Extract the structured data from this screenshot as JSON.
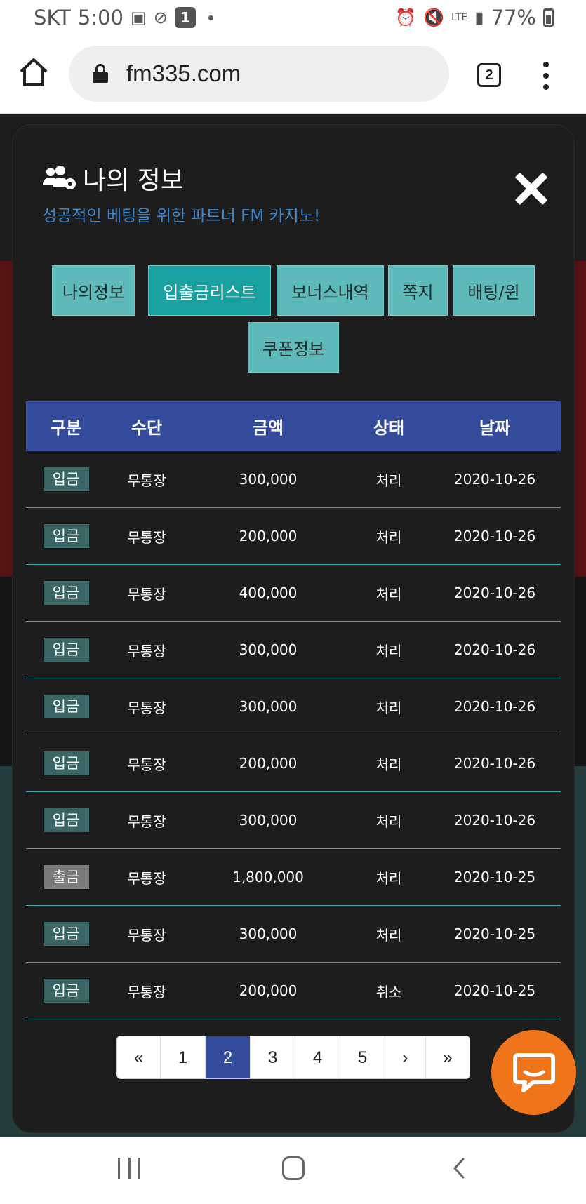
{
  "status_bar": {
    "carrier": "SKT",
    "time": "5:00",
    "notification_count": "1",
    "network": "LTE",
    "battery": "77%"
  },
  "browser": {
    "url": "fm335.com",
    "tab_count": "2"
  },
  "modal": {
    "title": "나의 정보",
    "subtitle": "성공적인 베팅을 위한 파트너 FM 카지노!",
    "tabs": [
      {
        "label": "나의정보",
        "active": false
      },
      {
        "label": "입출금리스트",
        "active": true
      },
      {
        "label": "보너스내역",
        "active": false
      },
      {
        "label": "쪽지",
        "active": false
      },
      {
        "label": "배팅/윈",
        "active": false
      },
      {
        "label": "쿠폰정보",
        "active": false
      }
    ],
    "table": {
      "headers": [
        "구분",
        "수단",
        "금액",
        "상태",
        "날짜"
      ],
      "rows": [
        {
          "type": "입금",
          "method": "무통장",
          "amount": "300,000",
          "status": "처리",
          "date": "2020-10-26"
        },
        {
          "type": "입금",
          "method": "무통장",
          "amount": "200,000",
          "status": "처리",
          "date": "2020-10-26"
        },
        {
          "type": "입금",
          "method": "무통장",
          "amount": "400,000",
          "status": "처리",
          "date": "2020-10-26"
        },
        {
          "type": "입금",
          "method": "무통장",
          "amount": "300,000",
          "status": "처리",
          "date": "2020-10-26"
        },
        {
          "type": "입금",
          "method": "무통장",
          "amount": "300,000",
          "status": "처리",
          "date": "2020-10-26"
        },
        {
          "type": "입금",
          "method": "무통장",
          "amount": "200,000",
          "status": "처리",
          "date": "2020-10-26"
        },
        {
          "type": "입금",
          "method": "무통장",
          "amount": "300,000",
          "status": "처리",
          "date": "2020-10-26"
        },
        {
          "type": "출금",
          "method": "무통장",
          "amount": "1,800,000",
          "status": "처리",
          "date": "2020-10-25"
        },
        {
          "type": "입금",
          "method": "무통장",
          "amount": "300,000",
          "status": "처리",
          "date": "2020-10-25"
        },
        {
          "type": "입금",
          "method": "무통장",
          "amount": "200,000",
          "status": "취소",
          "date": "2020-10-25"
        }
      ]
    },
    "pagination": {
      "first": "«",
      "pages": [
        "1",
        "2",
        "3",
        "4",
        "5"
      ],
      "current": "2",
      "next": "›",
      "last": "»"
    }
  },
  "colors": {
    "accent_blue": "#344b9c",
    "tab_teal": "#5dbab9",
    "tab_active": "#19a1a1",
    "deposit_badge": "#396565",
    "withdraw_badge": "#7a7a7a",
    "chat_orange": "#f07419",
    "subtitle_blue": "#3e86c8"
  },
  "icons": {
    "home": "home-icon",
    "lock": "lock-icon",
    "menu": "more-vert-icon",
    "close": "close-icon",
    "users": "users-gear-icon",
    "chat": "chat-bubble-icon"
  }
}
